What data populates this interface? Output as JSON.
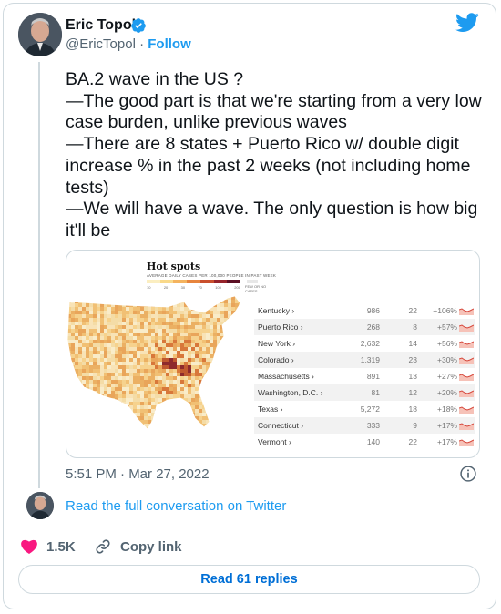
{
  "author": {
    "name": "Eric Topol",
    "handle": "@EricTopol",
    "separator": "·",
    "follow_label": "Follow"
  },
  "tweet": {
    "lines": [
      "BA.2 wave in the US ?",
      "—The good part is that we're starting from a very low",
      "case burden, unlike previous waves",
      "—There are 8 states + Puerto Rico w/ double digit",
      "increase % in the past 2 weeks (not including home",
      "tests)",
      "—We will have a wave. The only question is how big",
      "it'll be"
    ],
    "timestamp": "5:51 PM · Mar 27, 2022"
  },
  "media": {
    "title": "Hot spots",
    "legend_title": "AVERAGE DAILY CASES PER 100,000 PEOPLE IN PAST WEEK",
    "legend_ticks": [
      "10",
      "20",
      "30",
      "70",
      "100",
      "200"
    ],
    "legend_nocase": "FEW OR NO CASES",
    "legend_colors": [
      "#fbeec1",
      "#f9d98a",
      "#f4b35e",
      "#e7853d",
      "#c94f2d",
      "#96232a",
      "#5b0f23"
    ],
    "rows": [
      {
        "state": "Kentucky ›",
        "cases": "986",
        "per100k": "22",
        "change": "+106%"
      },
      {
        "state": "Puerto Rico ›",
        "cases": "268",
        "per100k": "8",
        "change": "+57%"
      },
      {
        "state": "New York ›",
        "cases": "2,632",
        "per100k": "14",
        "change": "+56%"
      },
      {
        "state": "Colorado ›",
        "cases": "1,319",
        "per100k": "23",
        "change": "+30%"
      },
      {
        "state": "Massachusetts ›",
        "cases": "891",
        "per100k": "13",
        "change": "+27%"
      },
      {
        "state": "Washington, D.C. ›",
        "cases": "81",
        "per100k": "12",
        "change": "+20%"
      },
      {
        "state": "Texas ›",
        "cases": "5,272",
        "per100k": "18",
        "change": "+18%"
      },
      {
        "state": "Connecticut ›",
        "cases": "333",
        "per100k": "9",
        "change": "+17%"
      },
      {
        "state": "Vermont ›",
        "cases": "140",
        "per100k": "22",
        "change": "+17%"
      }
    ]
  },
  "read_conversation": "Read the full conversation on Twitter",
  "actions": {
    "like_count": "1.5K",
    "copy_link_label": "Copy link",
    "replies_label": "Read 61 replies"
  },
  "colors": {
    "accent": "#1d9bf0",
    "heart": "#f91880",
    "replies_text": "#006fd6"
  }
}
